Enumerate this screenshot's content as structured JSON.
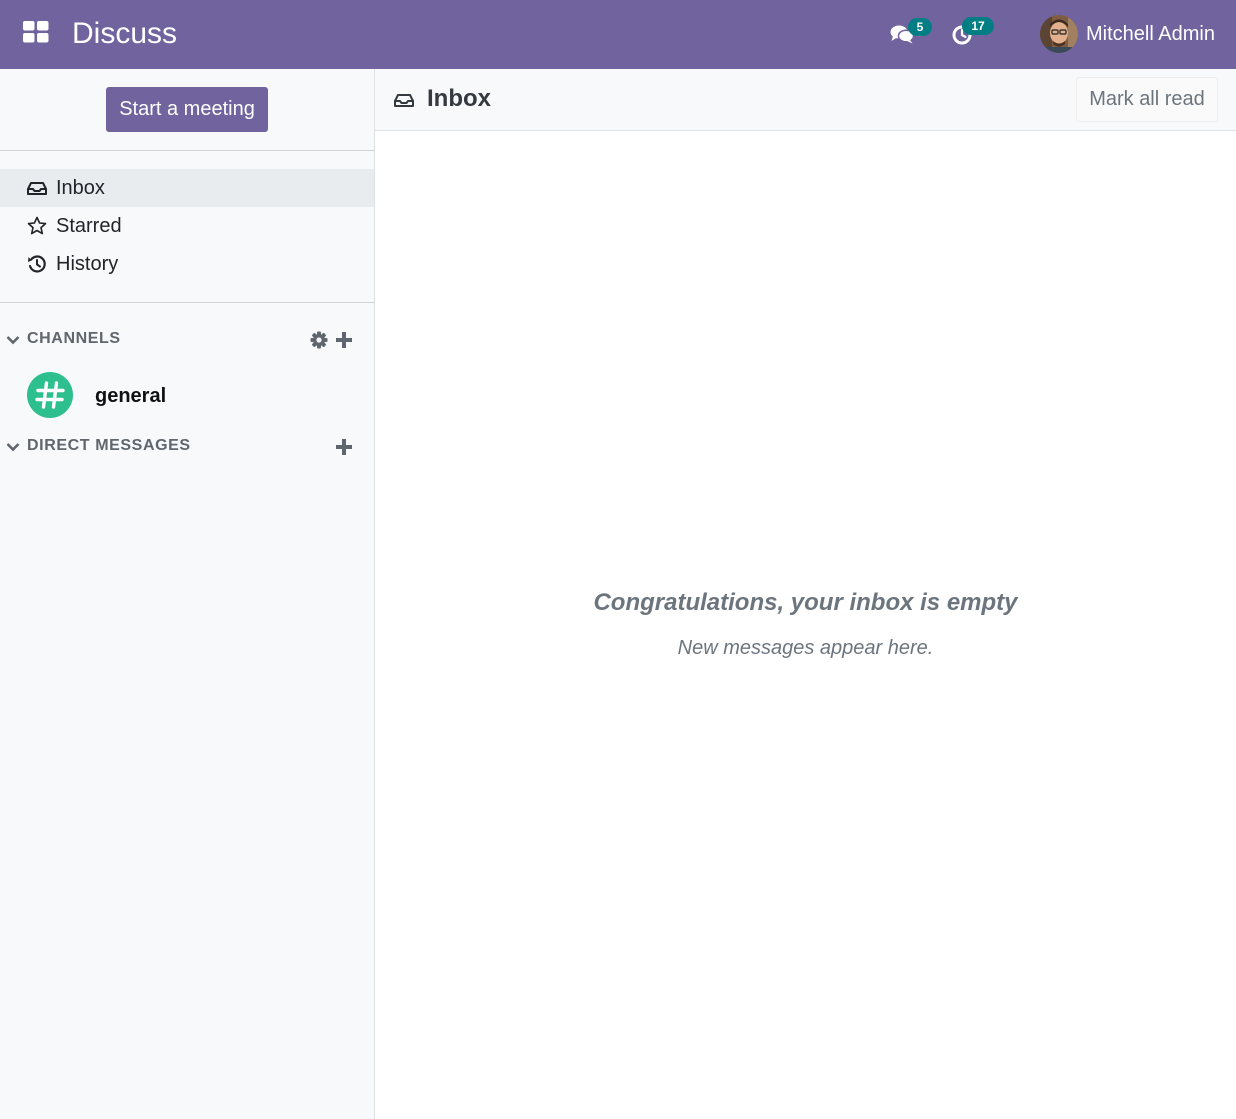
{
  "navbar": {
    "app_title": "Discuss",
    "apps_icon": "apps-grid-icon",
    "messages": {
      "icon": "comments-icon",
      "count": "5"
    },
    "activities": {
      "icon": "clock-icon",
      "count": "17"
    },
    "user": {
      "name": "Mitchell Admin"
    },
    "colors": {
      "brand": "#71639e",
      "badge": "#017e84"
    }
  },
  "sidebar": {
    "start_meeting_label": "Start a meeting",
    "mailboxes": [
      {
        "label": "Inbox",
        "icon": "inbox-icon",
        "active": true
      },
      {
        "label": "Starred",
        "icon": "star-icon",
        "active": false
      },
      {
        "label": "History",
        "icon": "history-icon",
        "active": false
      }
    ],
    "channels": {
      "label": "CHANNELS",
      "items": [
        {
          "name": "general",
          "avatar_color": "#2dbf8e"
        }
      ]
    },
    "direct_messages": {
      "label": "DIRECT MESSAGES"
    }
  },
  "main": {
    "title": "Inbox",
    "mark_all_read_label": "Mark all read",
    "empty_title": "Congratulations, your inbox is empty",
    "empty_subtitle": "New messages appear here."
  }
}
